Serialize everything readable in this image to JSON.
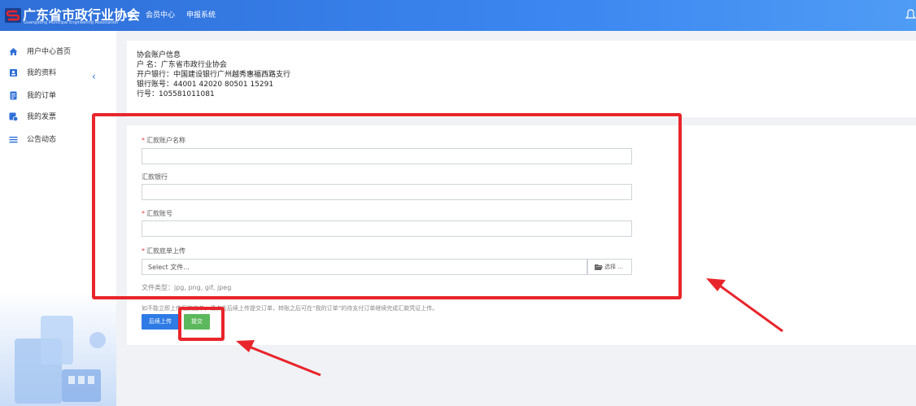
{
  "header": {
    "logo_title": "广东省市政行业协会",
    "logo_subtitle": "Guangdong Municipal Engineering Association",
    "nav": [
      "会员中心",
      "申报系统"
    ]
  },
  "sidebar": {
    "items": [
      {
        "label": "用户中心首页",
        "icon": "home-icon"
      },
      {
        "label": "我的资料",
        "icon": "profile-icon"
      },
      {
        "label": "我的订单",
        "icon": "order-icon"
      },
      {
        "label": "我的发票",
        "icon": "invoice-icon"
      },
      {
        "label": "公告动态",
        "icon": "list-icon"
      }
    ]
  },
  "account_info": {
    "title": "协会账户信息",
    "name_line": "户 名：广东省市政行业协会",
    "bank_line": "开户银行：中国建设银行广州越秀惠福西路支行",
    "account_line": "银行账号：44001 42020 80501 15291",
    "code_line": "行号：105581011081"
  },
  "form": {
    "account_name_label": "汇款账户名称",
    "bank_label": "汇款银行",
    "account_no_label": "汇款账号",
    "upload_label": "汇款底单上传",
    "file_placeholder": "Select 文件...",
    "choose_label": "选择 ...",
    "file_types": "文件类型：jpg, png, gif, jpeg",
    "hint": "如不能立即上传汇款底单，请点击后续上传提交订单，转账之后可在“我的订单”的待支付订单继续完成汇款凭证上传。",
    "later_button": "后续上传",
    "submit_button": "提交"
  },
  "colors": {
    "header": "#3b86f0",
    "primary": "#2e7be6",
    "success": "#5cb85c",
    "annotation": "#e8252b",
    "required": "#e03c3c"
  }
}
